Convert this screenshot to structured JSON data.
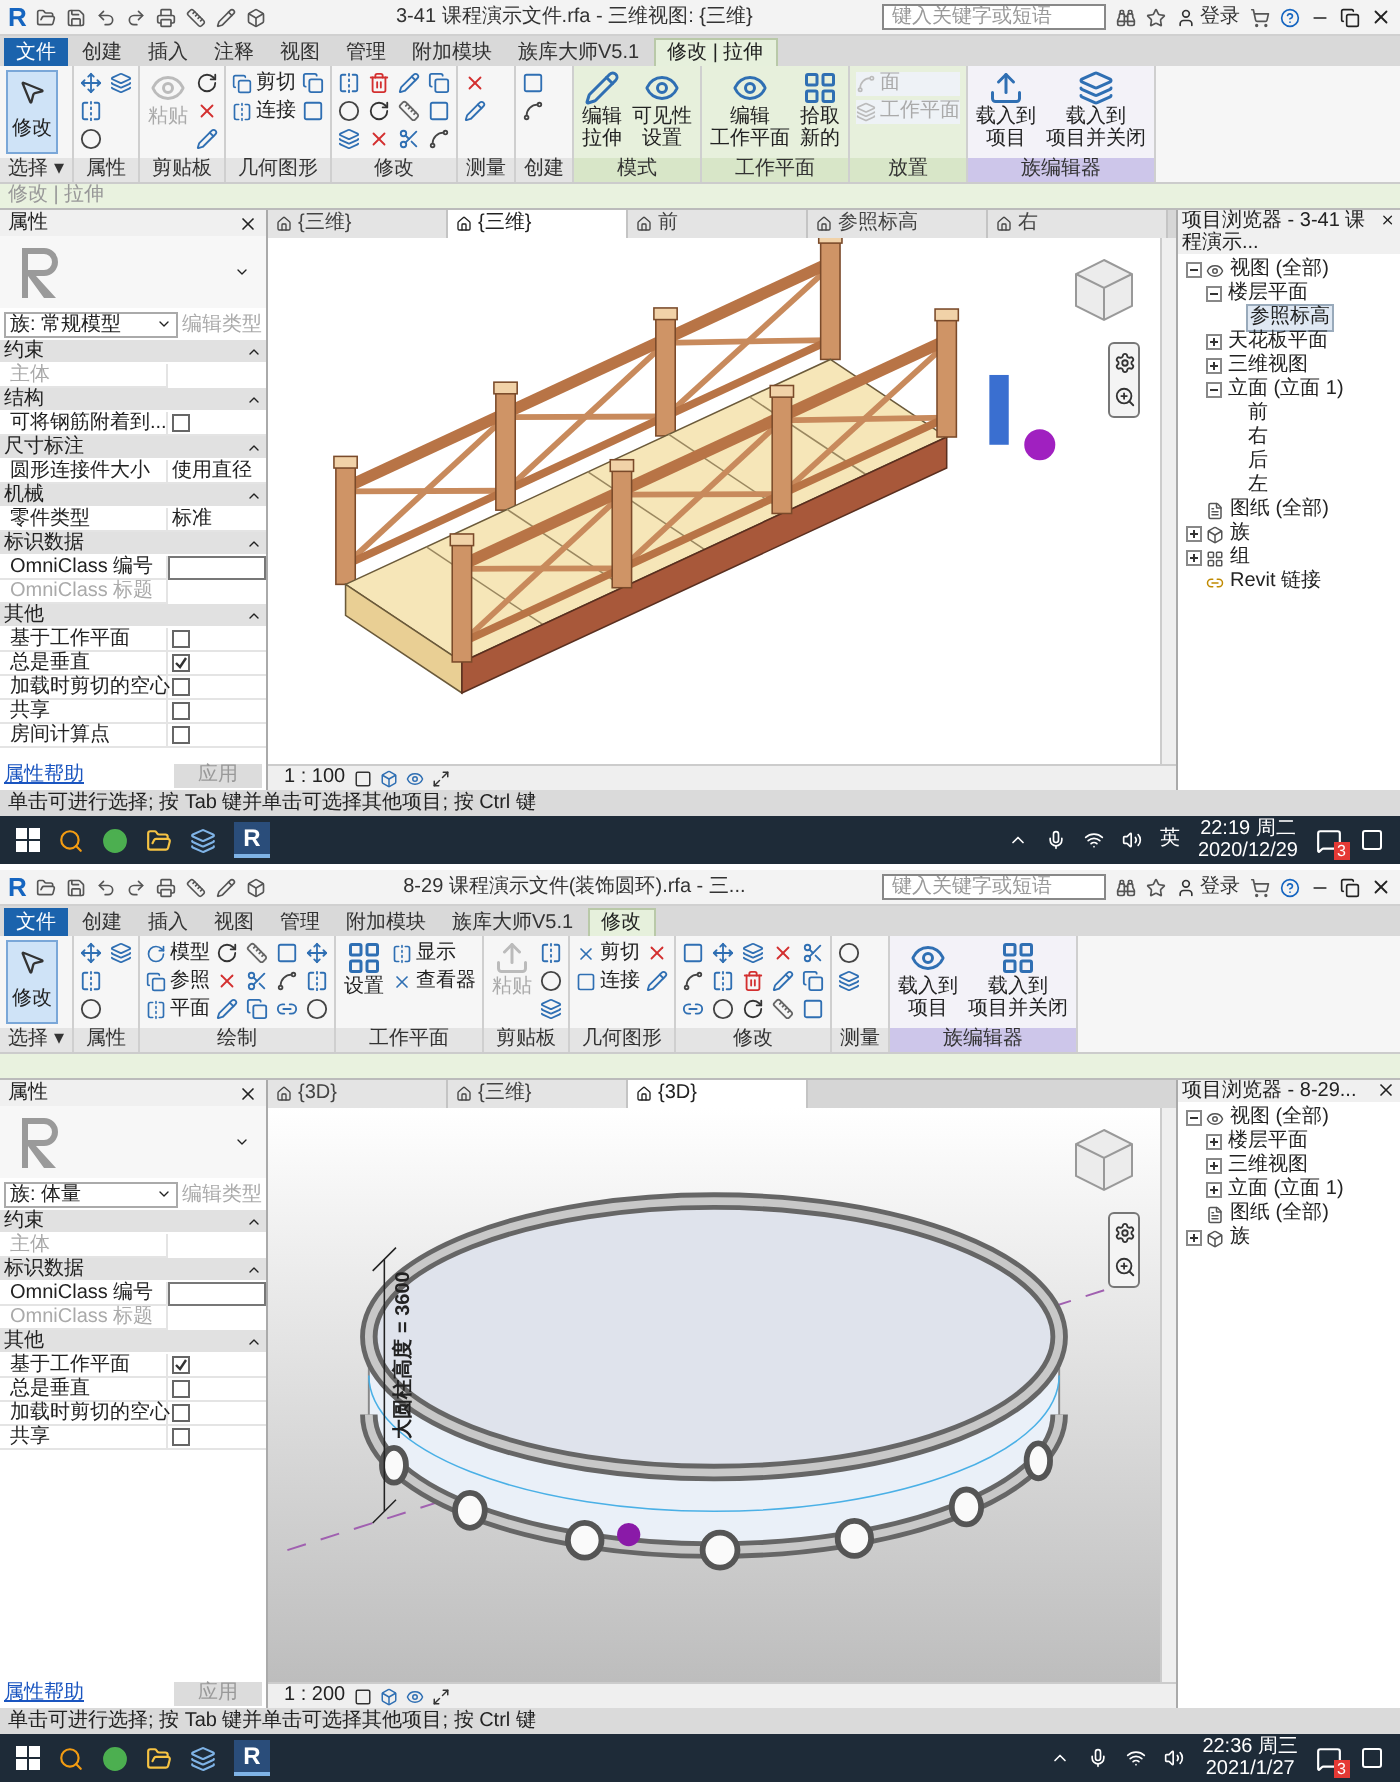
{
  "windows": [
    {
      "title_bar": {
        "logo": "R",
        "title": "3-41 课程演示文件.rfa - 三维视图: {三维}",
        "search_placeholder": "键入关键字或短语",
        "login": "登录"
      },
      "tabs": [
        {
          "label": "文件",
          "kind": "file",
          "selected": false
        },
        {
          "label": "创建",
          "kind": "tab",
          "selected": false
        },
        {
          "label": "插入",
          "kind": "tab",
          "selected": false
        },
        {
          "label": "注释",
          "kind": "tab",
          "selected": false
        },
        {
          "label": "视图",
          "kind": "tab",
          "selected": false
        },
        {
          "label": "管理",
          "kind": "tab",
          "selected": false
        },
        {
          "label": "附加模块",
          "kind": "tab",
          "selected": false
        },
        {
          "label": "族库大师V5.1",
          "kind": "tab",
          "selected": false
        },
        {
          "label": "修改 | 拉伸",
          "kind": "tab",
          "selected": true
        }
      ],
      "ribbon": [
        {
          "label": "选择 ▾",
          "kind": "normal",
          "items": [
            {
              "kind": "select",
              "label": "修改",
              "selected": true
            }
          ]
        },
        {
          "label": "属性",
          "kind": "normal",
          "items": [
            {
              "kind": "icon"
            },
            {
              "kind": "icon"
            },
            {
              "kind": "icon"
            },
            {
              "kind": "icon"
            }
          ]
        },
        {
          "label": "剪贴板",
          "kind": "normal",
          "items": [
            {
              "kind": "large",
              "label": "粘贴",
              "disabled": true
            },
            {
              "kind": "icon"
            },
            {
              "kind": "icon"
            },
            {
              "kind": "icon"
            }
          ]
        },
        {
          "label": "几何图形",
          "kind": "normal",
          "items": [
            {
              "kind": "small",
              "label": "剪切",
              "disabled": false
            },
            {
              "kind": "small",
              "label": "连接",
              "disabled": false
            },
            {
              "kind": "icon"
            },
            {
              "kind": "icon"
            }
          ]
        },
        {
          "label": "修改",
          "kind": "normal",
          "items": [
            {
              "kind": "icon"
            },
            {
              "kind": "icon"
            },
            {
              "kind": "icon"
            },
            {
              "kind": "icon"
            },
            {
              "kind": "icon"
            },
            {
              "kind": "icon"
            },
            {
              "kind": "icon"
            },
            {
              "kind": "icon"
            },
            {
              "kind": "icon"
            },
            {
              "kind": "icon"
            },
            {
              "kind": "icon"
            },
            {
              "kind": "icon"
            }
          ]
        },
        {
          "label": "测量",
          "kind": "normal",
          "items": [
            {
              "kind": "icon"
            },
            {
              "kind": "icon"
            }
          ]
        },
        {
          "label": "创建",
          "kind": "normal",
          "items": [
            {
              "kind": "icon"
            },
            {
              "kind": "icon"
            }
          ]
        },
        {
          "label": "模式",
          "kind": "context",
          "items": [
            {
              "kind": "large",
              "lines": [
                "编辑",
                "拉伸"
              ],
              "disabled": false
            },
            {
              "kind": "large",
              "lines": [
                "可见性",
                "设置"
              ],
              "disabled": false
            }
          ]
        },
        {
          "label": "工作平面",
          "kind": "context",
          "items": [
            {
              "kind": "large",
              "lines": [
                "编辑",
                "工作平面"
              ],
              "disabled": false
            },
            {
              "kind": "large",
              "lines": [
                "拾取",
                "新的"
              ],
              "disabled": false
            }
          ]
        },
        {
          "label": "放置",
          "kind": "context",
          "items": [
            {
              "kind": "small",
              "label": "面",
              "disabled": true
            },
            {
              "kind": "small",
              "label": "工作平面",
              "disabled": true
            }
          ]
        },
        {
          "label": "族编辑器",
          "kind": "editor",
          "items": [
            {
              "kind": "large",
              "lines": [
                "载入到",
                "项目"
              ],
              "disabled": false
            },
            {
              "kind": "large",
              "lines": [
                "载入到",
                "项目并关闭"
              ],
              "disabled": false
            }
          ]
        }
      ],
      "options_bar": "修改 | 拉伸",
      "properties": {
        "title": "属性",
        "type": "族: 常规模型",
        "edit_type": "编辑类型",
        "groups": [
          {
            "name": "约束",
            "rows": [
              {
                "label": "主体",
                "kind": "field",
                "disabled": true
              }
            ]
          },
          {
            "name": "结构",
            "rows": [
              {
                "label": "可将钢筋附着到...",
                "kind": "checkbox",
                "checked": false,
                "disabled": false
              }
            ]
          },
          {
            "name": "尺寸标注",
            "rows": [
              {
                "label": "圆形连接件大小",
                "kind": "text",
                "value": "使用直径",
                "disabled": false
              }
            ]
          },
          {
            "name": "机械",
            "rows": [
              {
                "label": "零件类型",
                "kind": "text",
                "value": "标准",
                "disabled": false
              }
            ]
          },
          {
            "name": "标识数据",
            "rows": [
              {
                "label": "OmniClass 编号",
                "kind": "field",
                "disabled": false
              },
              {
                "label": "OmniClass 标题",
                "kind": "field",
                "disabled": true
              }
            ]
          },
          {
            "name": "其他",
            "rows": [
              {
                "label": "基于工作平面",
                "kind": "checkbox",
                "checked": false,
                "disabled": false
              },
              {
                "label": "总是垂直",
                "kind": "checkbox",
                "checked": true,
                "disabled": false
              },
              {
                "label": "加载时剪切的空心",
                "kind": "checkbox",
                "checked": false,
                "disabled": false
              },
              {
                "label": "共享",
                "kind": "checkbox",
                "checked": false,
                "disabled": false
              },
              {
                "label": "房间计算点",
                "kind": "checkbox",
                "checked": false,
                "disabled": false
              }
            ]
          }
        ],
        "help": "属性帮助",
        "apply": "应用"
      },
      "view": {
        "kind": "bridge",
        "tabs": [
          {
            "label": "{三维}",
            "selected": false
          },
          {
            "label": "{三维}",
            "selected": true
          },
          {
            "label": "前",
            "selected": false
          },
          {
            "label": "参照标高",
            "selected": false
          },
          {
            "label": "右",
            "selected": false
          }
        ],
        "scale": "1 : 100"
      },
      "browser": {
        "title": "项目浏览器 - 3-41 课程演示...",
        "tree": [
          {
            "label": "视图 (全部)",
            "kind": "views",
            "expanded": true,
            "selected": false,
            "children": [
              {
                "label": "楼层平面",
                "expanded": true,
                "selected": false,
                "children": [
                  {
                    "label": "参照标高",
                    "selected": true
                  }
                ]
              },
              {
                "label": "天花板平面",
                "expanded": false,
                "selected": false
              },
              {
                "label": "三维视图",
                "expanded": false,
                "selected": false
              },
              {
                "label": "立面 (立面 1)",
                "expanded": true,
                "selected": false,
                "children": [
                  {
                    "label": "前",
                    "selected": false
                  },
                  {
                    "label": "右",
                    "selected": false
                  },
                  {
                    "label": "后",
                    "selected": false
                  },
                  {
                    "label": "左",
                    "selected": false
                  }
                ]
              }
            ]
          },
          {
            "label": "图纸 (全部)",
            "kind": "sheets",
            "selected": false
          },
          {
            "label": "族",
            "kind": "families",
            "expanded": false,
            "selected": false
          },
          {
            "label": "组",
            "kind": "groups",
            "expanded": false,
            "selected": false
          },
          {
            "label": "Revit 链接",
            "kind": "links",
            "selected": false
          }
        ]
      },
      "status": "单击可进行选择; 按 Tab 键并单击可选择其他项目; 按 Ctrl 键",
      "taskbar": {
        "app": "R",
        "ime": "英",
        "time": "22:19 周二",
        "date": "2020/12/29",
        "badge": "3"
      }
    },
    {
      "title_bar": {
        "logo": "R",
        "title": "8-29 课程演示文件(装饰圆环).rfa - 三...",
        "search_placeholder": "键入关键字或短语",
        "login": "登录"
      },
      "tabs": [
        {
          "label": "文件",
          "kind": "file",
          "selected": false
        },
        {
          "label": "创建",
          "kind": "tab",
          "selected": false
        },
        {
          "label": "插入",
          "kind": "tab",
          "selected": false
        },
        {
          "label": "视图",
          "kind": "tab",
          "selected": false
        },
        {
          "label": "管理",
          "kind": "tab",
          "selected": false
        },
        {
          "label": "附加模块",
          "kind": "tab",
          "selected": false
        },
        {
          "label": "族库大师V5.1",
          "kind": "tab",
          "selected": false
        },
        {
          "label": "修改",
          "kind": "tab",
          "selected": true
        }
      ],
      "ribbon": [
        {
          "label": "选择 ▾",
          "kind": "normal",
          "items": [
            {
              "kind": "select",
              "label": "修改",
              "selected": true
            }
          ]
        },
        {
          "label": "属性",
          "kind": "normal",
          "items": [
            {
              "kind": "icon"
            },
            {
              "kind": "icon"
            },
            {
              "kind": "icon"
            },
            {
              "kind": "icon"
            }
          ]
        },
        {
          "label": "绘制",
          "kind": "normal",
          "items": [
            {
              "kind": "small",
              "label": "模型",
              "disabled": false
            },
            {
              "kind": "small",
              "label": "参照",
              "disabled": false
            },
            {
              "kind": "small",
              "label": "平面",
              "disabled": false
            },
            {
              "kind": "icon"
            },
            {
              "kind": "icon"
            },
            {
              "kind": "icon"
            },
            {
              "kind": "icon"
            },
            {
              "kind": "icon"
            },
            {
              "kind": "icon"
            },
            {
              "kind": "icon"
            },
            {
              "kind": "icon"
            },
            {
              "kind": "icon"
            },
            {
              "kind": "icon"
            },
            {
              "kind": "icon"
            },
            {
              "kind": "icon"
            }
          ]
        },
        {
          "label": "工作平面",
          "kind": "normal",
          "items": [
            {
              "kind": "large",
              "lines": [
                "设置"
              ],
              "disabled": false
            },
            {
              "kind": "small",
              "label": "显示",
              "disabled": false
            },
            {
              "kind": "small",
              "label": "查看器",
              "disabled": false
            }
          ]
        },
        {
          "label": "剪贴板",
          "kind": "normal",
          "items": [
            {
              "kind": "large",
              "label": "粘贴",
              "disabled": true
            },
            {
              "kind": "icon"
            },
            {
              "kind": "icon"
            },
            {
              "kind": "icon"
            }
          ]
        },
        {
          "label": "几何图形",
          "kind": "normal",
          "items": [
            {
              "kind": "small",
              "label": "剪切",
              "disabled": false
            },
            {
              "kind": "small",
              "label": "连接",
              "disabled": false
            },
            {
              "kind": "icon"
            },
            {
              "kind": "icon"
            }
          ]
        },
        {
          "label": "修改",
          "kind": "normal",
          "items": [
            {
              "kind": "icon"
            },
            {
              "kind": "icon"
            },
            {
              "kind": "icon"
            },
            {
              "kind": "icon"
            },
            {
              "kind": "icon"
            },
            {
              "kind": "icon"
            },
            {
              "kind": "icon"
            },
            {
              "kind": "icon"
            },
            {
              "kind": "icon"
            },
            {
              "kind": "icon"
            },
            {
              "kind": "icon"
            },
            {
              "kind": "icon"
            },
            {
              "kind": "icon"
            },
            {
              "kind": "icon"
            },
            {
              "kind": "icon"
            }
          ]
        },
        {
          "label": "测量",
          "kind": "normal",
          "items": [
            {
              "kind": "icon"
            },
            {
              "kind": "icon"
            }
          ]
        },
        {
          "label": "族编辑器",
          "kind": "editor",
          "items": [
            {
              "kind": "large",
              "lines": [
                "载入到",
                "项目"
              ],
              "disabled": false
            },
            {
              "kind": "large",
              "lines": [
                "载入到",
                "项目并关闭"
              ],
              "disabled": false
            }
          ]
        }
      ],
      "properties": {
        "title": "属性",
        "type": "族: 体量",
        "edit_type": "编辑类型",
        "groups": [
          {
            "name": "约束",
            "rows": [
              {
                "label": "主体",
                "kind": "field",
                "disabled": true
              }
            ]
          },
          {
            "name": "标识数据",
            "rows": [
              {
                "label": "OmniClass 编号",
                "kind": "field",
                "disabled": false
              },
              {
                "label": "OmniClass 标题",
                "kind": "field",
                "disabled": true
              }
            ]
          },
          {
            "name": "其他",
            "rows": [
              {
                "label": "基于工作平面",
                "kind": "checkbox",
                "checked": true,
                "disabled": false
              },
              {
                "label": "总是垂直",
                "kind": "checkbox",
                "checked": false,
                "disabled": false
              },
              {
                "label": "加载时剪切的空心",
                "kind": "checkbox",
                "checked": false,
                "disabled": false
              },
              {
                "label": "共享",
                "kind": "checkbox",
                "checked": false,
                "disabled": false
              }
            ]
          }
        ],
        "help": "属性帮助",
        "apply": "应用"
      },
      "view": {
        "kind": "ring",
        "tabs": [
          {
            "label": "{3D}",
            "selected": false
          },
          {
            "label": "{三维}",
            "selected": false
          },
          {
            "label": "{3D}",
            "selected": true
          }
        ],
        "scale": "1 : 200",
        "dimension": "大圆柱高度 = 3600"
      },
      "browser": {
        "title": "项目浏览器 - 8-29...",
        "tree": [
          {
            "label": "视图 (全部)",
            "kind": "views",
            "expanded": true,
            "selected": false,
            "children": [
              {
                "label": "楼层平面",
                "expanded": false,
                "selected": false
              },
              {
                "label": "三维视图",
                "expanded": false,
                "selected": false
              },
              {
                "label": "立面 (立面 1)",
                "expanded": false,
                "selected": false
              }
            ]
          },
          {
            "label": "图纸 (全部)",
            "kind": "sheets",
            "selected": false
          },
          {
            "label": "族",
            "kind": "families",
            "expanded": false,
            "selected": false
          }
        ]
      },
      "status": "单击可进行选择; 按 Tab 键并单击可选择其他项目; 按 Ctrl 键",
      "taskbar": {
        "app": "R",
        "time": "22:36 周三",
        "date": "2021/1/27",
        "badge": "3"
      }
    }
  ]
}
